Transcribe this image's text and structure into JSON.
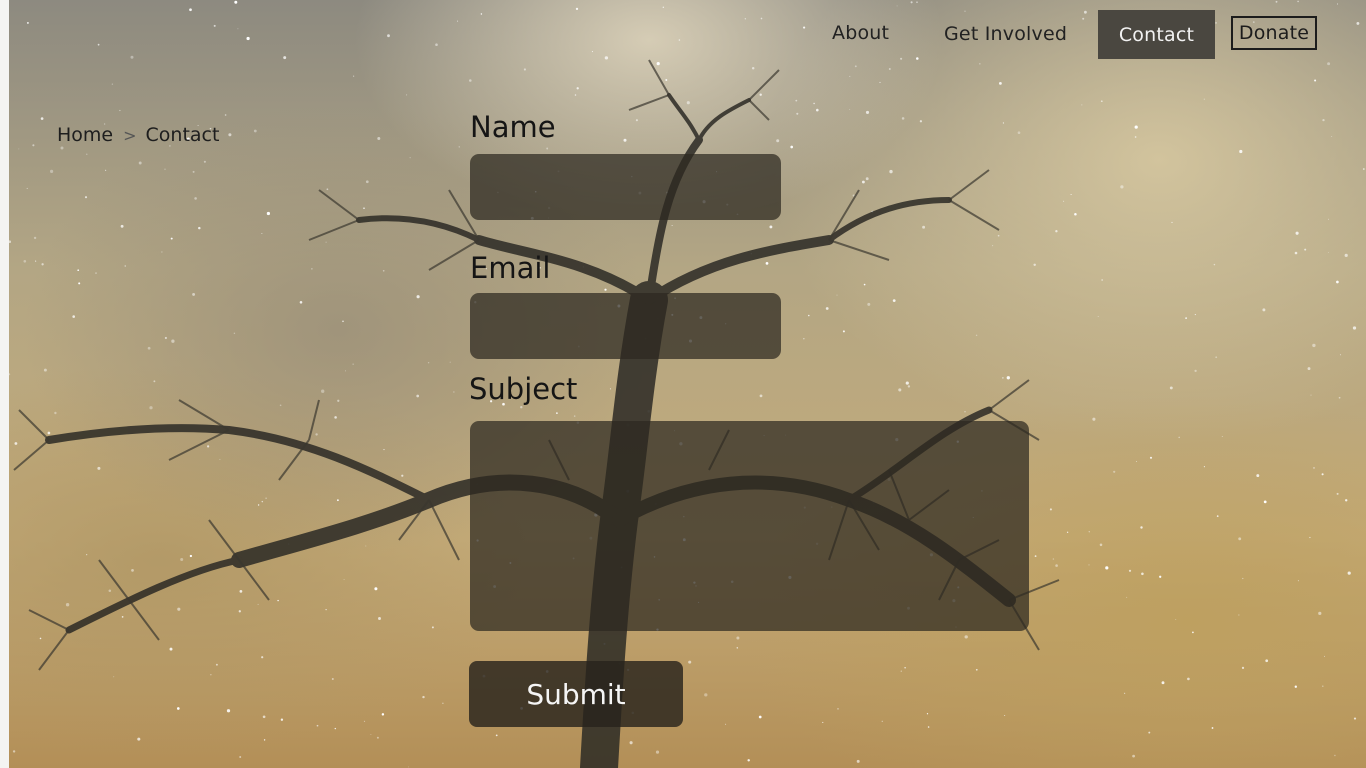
{
  "nav": {
    "items": [
      {
        "label": "About"
      },
      {
        "label": "Get Involved"
      },
      {
        "label": "Contact",
        "active": true
      },
      {
        "label": "Donate"
      }
    ]
  },
  "breadcrumb": {
    "home": "Home",
    "separator": ">",
    "current": "Contact"
  },
  "form": {
    "name_label": "Name",
    "name_value": "",
    "email_label": "Email",
    "email_value": "",
    "subject_label": "Subject",
    "subject_value": "",
    "submit_label": "Submit"
  },
  "colors": {
    "active_nav_bg": "#4a4740",
    "field_bg": "#2d2820",
    "text_dark": "#1e1e1e",
    "text_light": "#f2f2f2"
  }
}
